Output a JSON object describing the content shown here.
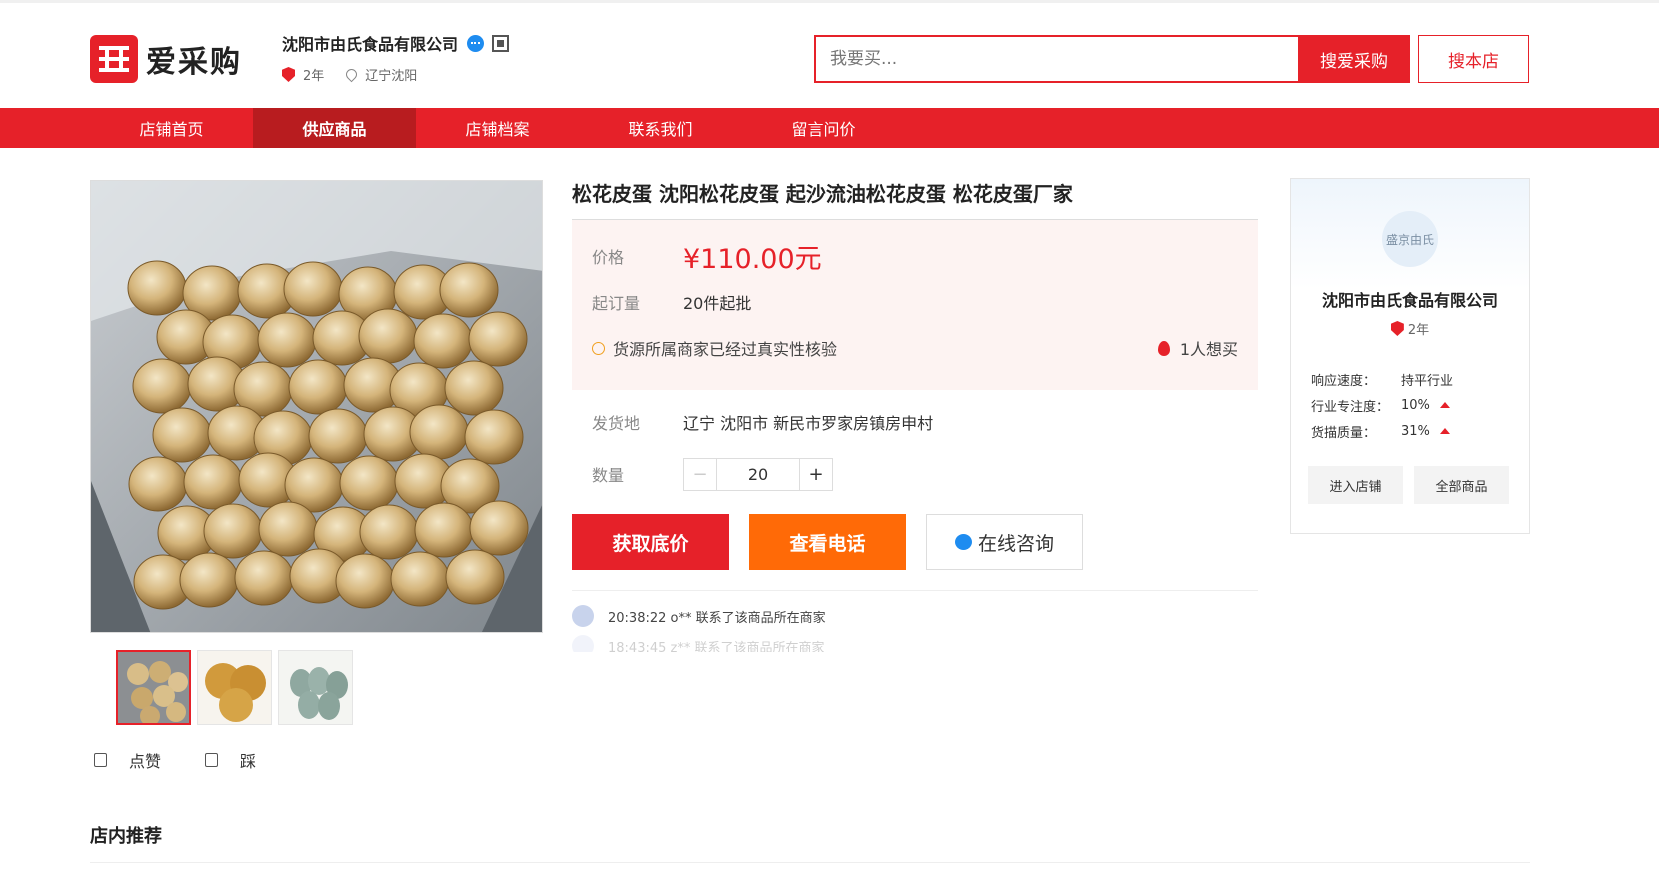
{
  "header": {
    "logo_text": "爱采购",
    "shop_name": "沈阳市由氏食品有限公司",
    "shop_age": "2年",
    "shop_location": "辽宁沈阳",
    "search_placeholder": "我要买...",
    "search_button": "搜爱采购",
    "store_search_button": "搜本店"
  },
  "nav": {
    "items": [
      {
        "label": "店铺首页"
      },
      {
        "label": "供应商品"
      },
      {
        "label": "店铺档案"
      },
      {
        "label": "联系我们"
      },
      {
        "label": "留言问价"
      }
    ],
    "active_index": 1
  },
  "product": {
    "title": "松花皮蛋 沈阳松花皮蛋 起沙流油松花皮蛋 松花皮蛋厂家",
    "price_label": "价格",
    "price": "¥110.00元",
    "moq_label": "起订量",
    "moq": "20件起批",
    "verified_text": "货源所属商家已经过真实性核验",
    "want_count": "1人想买",
    "ship_label": "发货地",
    "ship_from": "辽宁 沈阳市 新民市罗家房镇房申村",
    "qty_label": "数量",
    "qty_value": "20",
    "qty_minus": "−",
    "qty_plus": "+",
    "btn_lowest_price": "获取底价",
    "btn_phone": "查看电话",
    "btn_consult": "在线咨询",
    "like_label": "点赞",
    "dislike_label": "踩"
  },
  "feed": [
    {
      "text": "20:38:22 o** 联系了该商品所在商家"
    },
    {
      "text": "18:43:45 z** 联系了该商品所在商家"
    }
  ],
  "shop_card": {
    "logo_text": "盛京由氏",
    "name": "沈阳市由氏食品有限公司",
    "age": "2年",
    "stats": [
      {
        "key": "响应速度：",
        "value": "持平行业"
      },
      {
        "key": "行业专注度：",
        "value": "10%"
      },
      {
        "key": "货描质量：",
        "value": "31%"
      }
    ],
    "btn_enter": "进入店铺",
    "btn_all": "全部商品"
  },
  "recommend_title": "店内推荐",
  "colors": {
    "brand_red": "#e62129",
    "orange": "#ff6a07",
    "nav_active": "#b81c1f"
  }
}
